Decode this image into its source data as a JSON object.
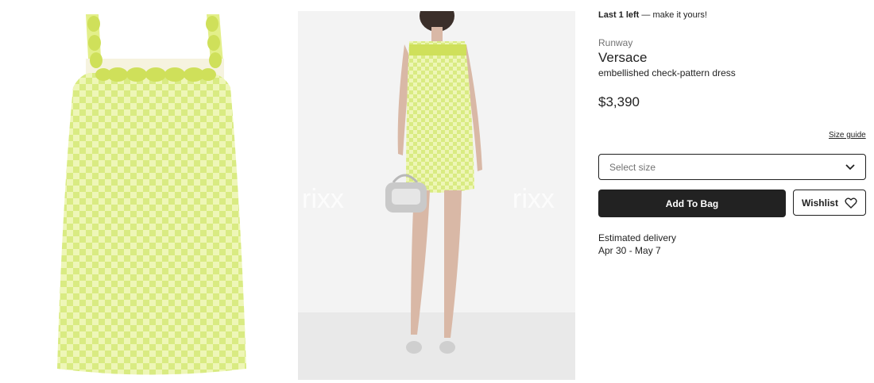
{
  "stock": {
    "label": "Last 1 left",
    "message": "make it yours!"
  },
  "product": {
    "category": "Runway",
    "brand": "Versace",
    "description": "embellished check-pattern dress",
    "price": "$3,390"
  },
  "size": {
    "guide_label": "Size guide",
    "placeholder": "Select size"
  },
  "actions": {
    "add_to_bag_label": "Add To Bag",
    "wishlist_label": "Wishlist"
  },
  "delivery": {
    "label": "Estimated delivery",
    "dates": "Apr 30 - May 7"
  },
  "images": {
    "flat_alt": "dress product image",
    "model_alt": "model wearing dress",
    "watermark": "rixx"
  },
  "colors": {
    "dress_light": "#eef6b7",
    "dress_check": "#d8ea80",
    "embellishment": "#cfe05a",
    "button_dark": "#222222",
    "text_muted": "#727272"
  },
  "icons": {
    "chevron": "chevron-down-icon",
    "wishlist": "heart-icon"
  }
}
